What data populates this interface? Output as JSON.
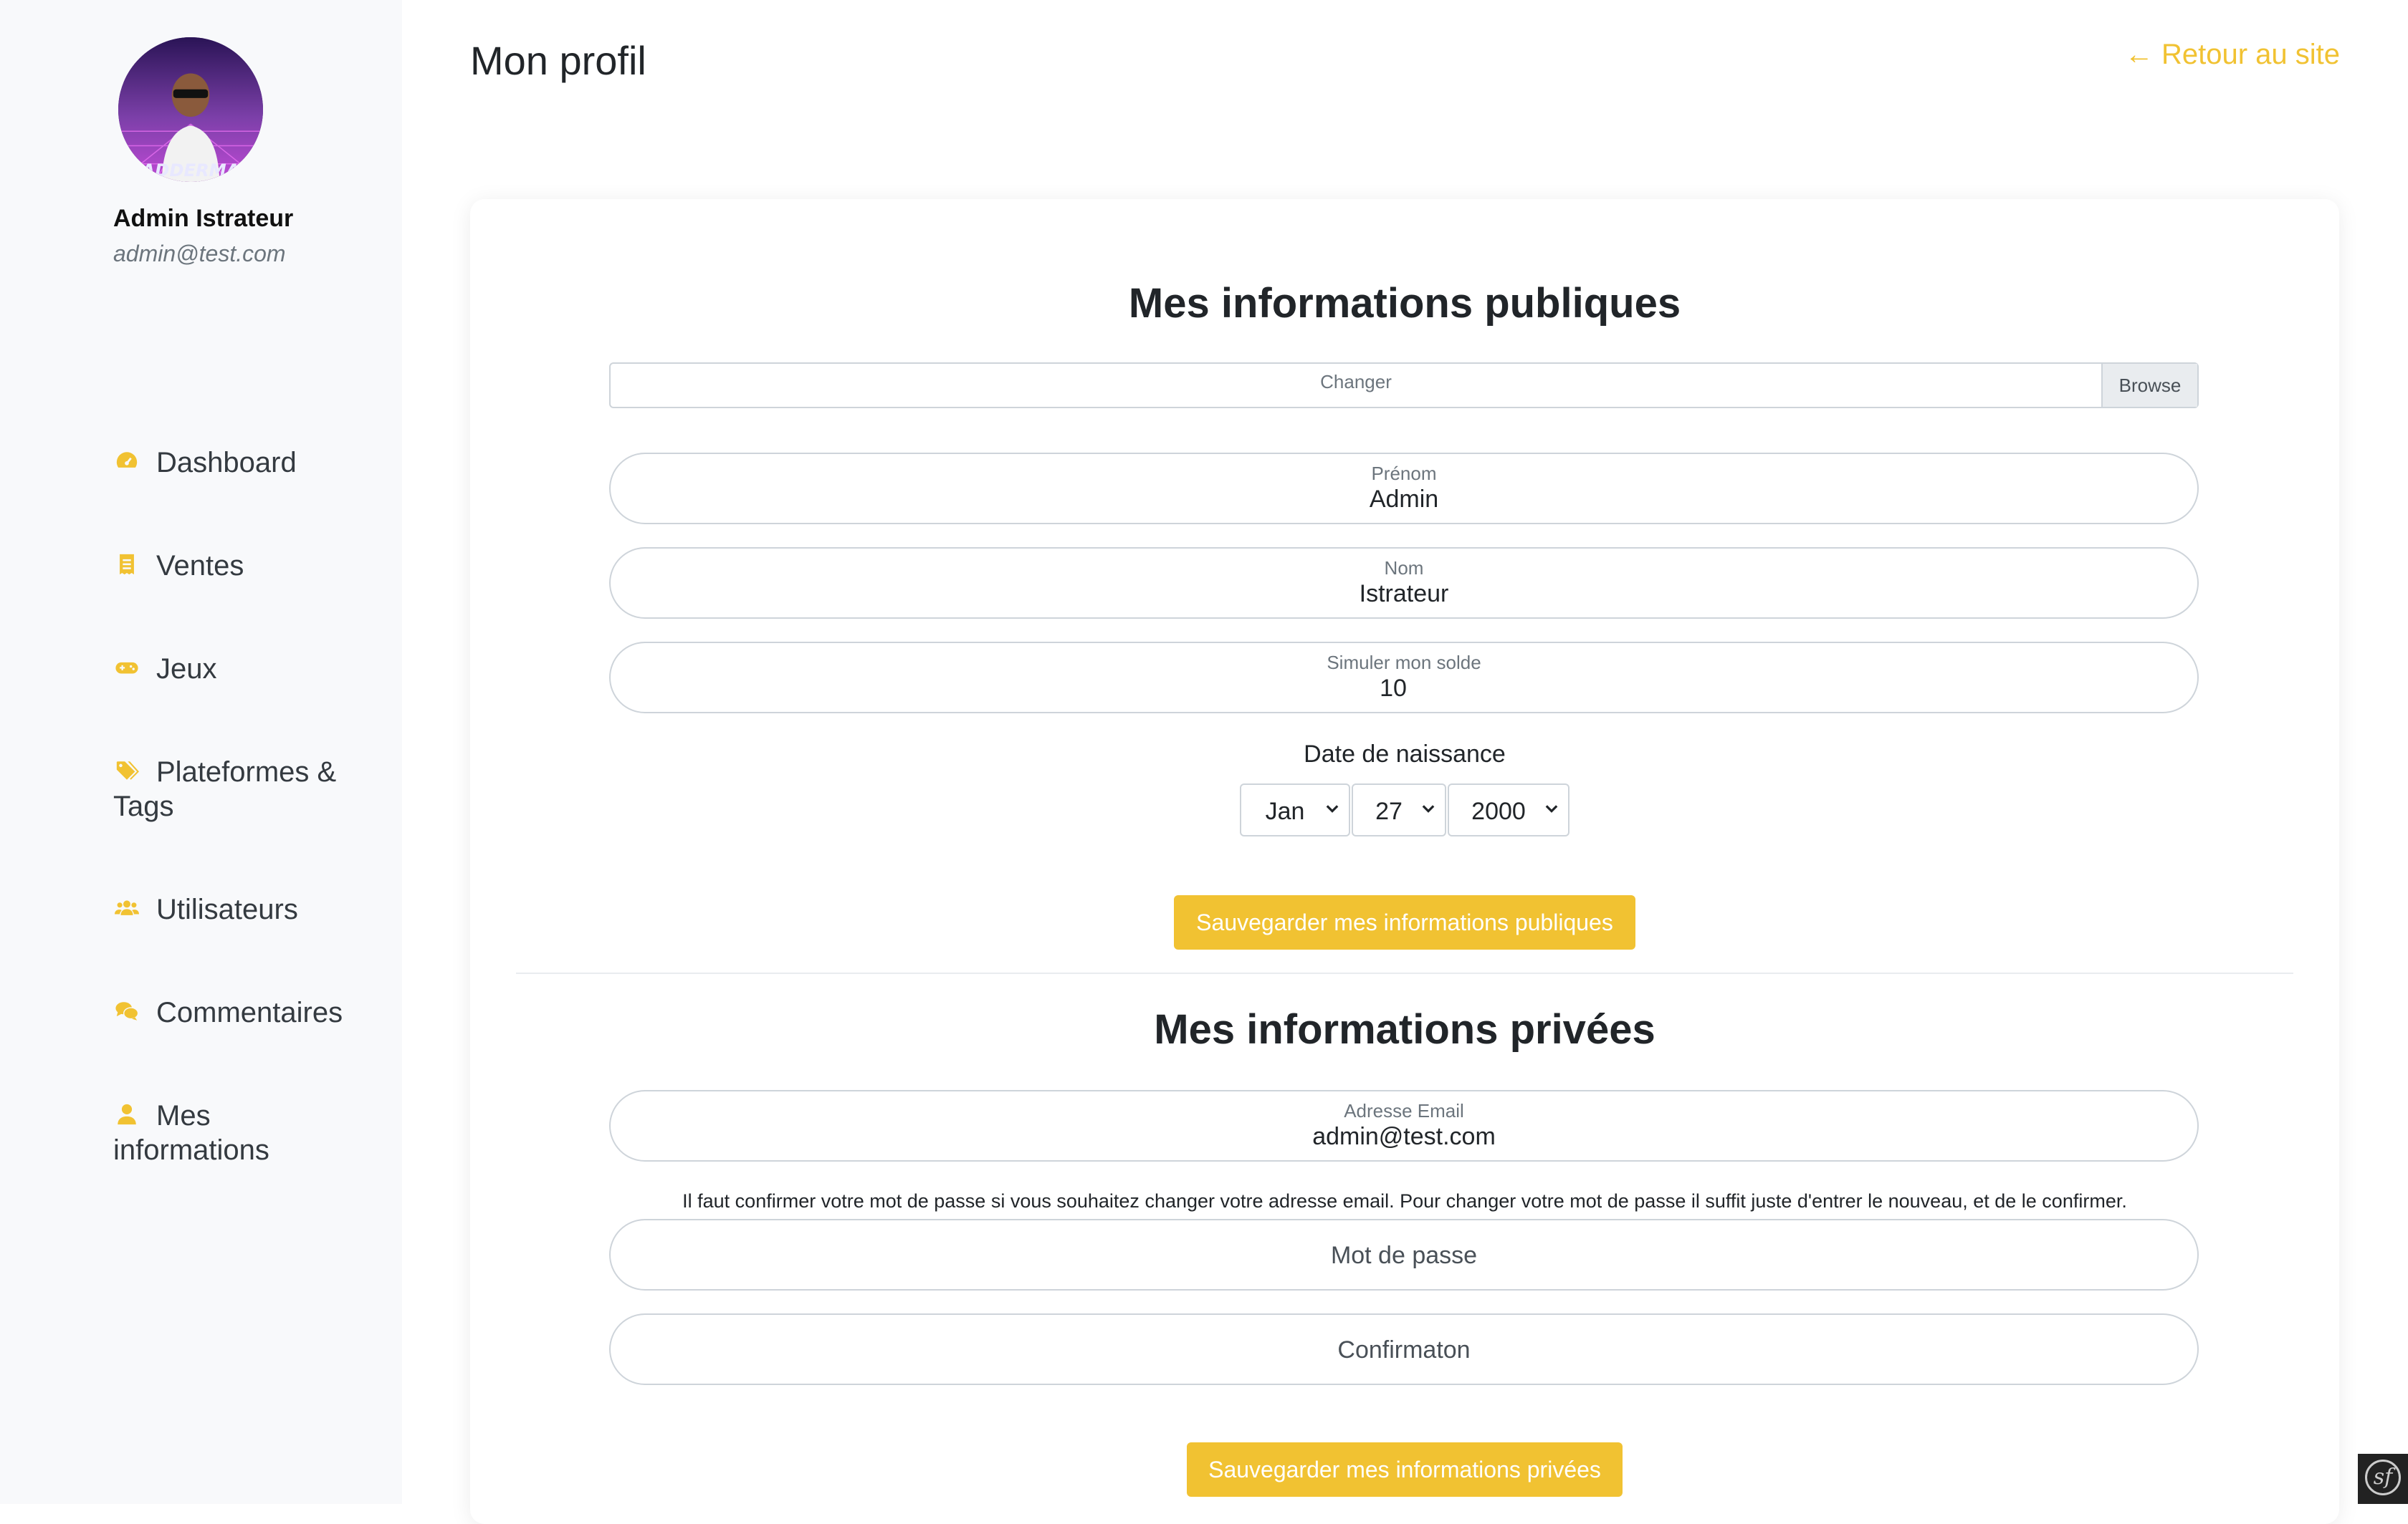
{
  "sidebar": {
    "user_name": "Admin Istrateur",
    "user_email": "admin@test.com",
    "items": [
      {
        "label": "Dashboard",
        "icon": "dashboard-icon"
      },
      {
        "label": "Ventes",
        "icon": "receipt-icon"
      },
      {
        "label": "Jeux",
        "icon": "gamepad-icon"
      },
      {
        "label": "Plateformes & Tags",
        "icon": "tags-icon"
      },
      {
        "label": "Utilisateurs",
        "icon": "users-icon"
      },
      {
        "label": "Commentaires",
        "icon": "comments-icon"
      },
      {
        "label": "Mes informations",
        "icon": "user-icon"
      }
    ],
    "accent_color": "#f1c232"
  },
  "header": {
    "title": "Mon profil",
    "back_link": "Retour au site",
    "back_icon": "arrow-left-icon"
  },
  "public_section": {
    "title": "Mes informations publiques",
    "file_label": "Changer",
    "browse_label": "Browse",
    "first_name": {
      "label": "Prénom",
      "value": "Admin"
    },
    "last_name": {
      "label": "Nom",
      "value": "Istrateur"
    },
    "balance": {
      "label": "Simuler mon solde",
      "value": "10"
    },
    "dob_label": "Date de naissance",
    "dob": {
      "month": "Jan",
      "day": "27",
      "year": "2000"
    },
    "save_label": "Sauvegarder mes informations publiques"
  },
  "private_section": {
    "title": "Mes informations privées",
    "email": {
      "label": "Adresse Email",
      "value": "admin@test.com"
    },
    "note": "Il faut confirmer votre mot de passe si vous souhaitez changer votre adresse email. Pour changer votre mot de passe il suffit juste d'entrer le nouveau, et de le confirmer.",
    "password_placeholder": "Mot de passe",
    "confirm_placeholder": "Confirmaton",
    "save_label": "Sauvegarder mes informations privées"
  }
}
